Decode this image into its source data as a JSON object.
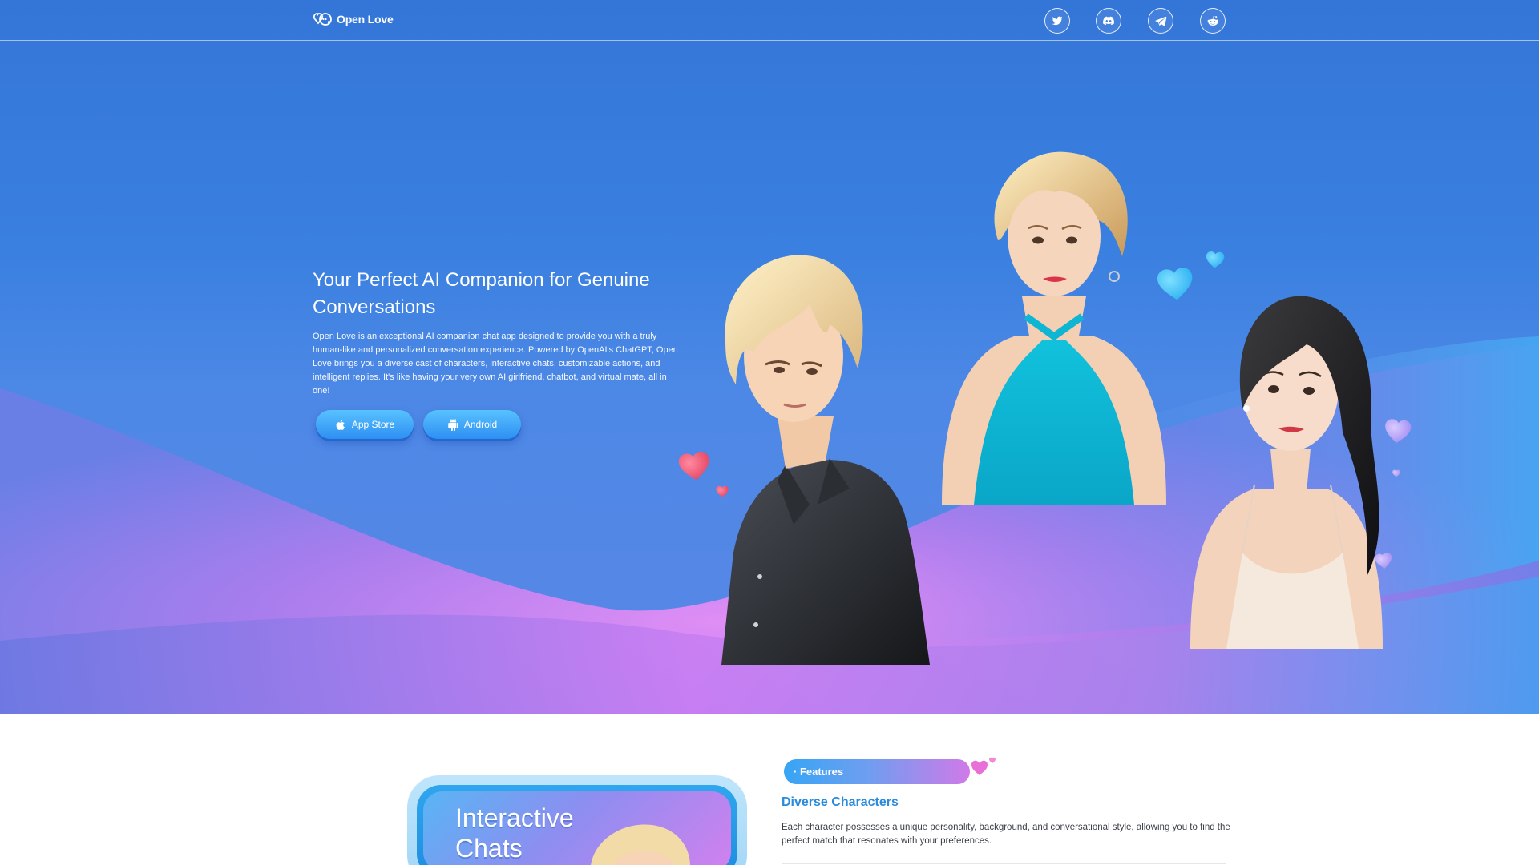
{
  "brand": {
    "name": "Open Love"
  },
  "social": [
    {
      "name": "twitter",
      "icon": "twitter-icon"
    },
    {
      "name": "discord",
      "icon": "discord-icon"
    },
    {
      "name": "telegram",
      "icon": "telegram-icon"
    },
    {
      "name": "reddit",
      "icon": "reddit-icon"
    }
  ],
  "hero": {
    "title": "Your Perfect AI Companion for Genuine Conversations",
    "description": "Open Love is an exceptional AI companion chat app designed to provide you with a truly human-like and personalized conversation experience. Powered by OpenAI's ChatGPT, Open Love brings you a diverse cast of characters, interactive chats, customizable actions, and intelligent replies. It's like having your very own AI girlfriend, chatbot, and virtual mate, all in one!",
    "buttons": {
      "app_store": "App Store",
      "android": "Android"
    }
  },
  "promo": {
    "title": "Interactive Chats"
  },
  "features": {
    "badge": "· Features",
    "title": "Diverse Characters",
    "description": "Each character possesses a unique personality, background, and conversational style, allowing you to find the perfect match that resonates with your preferences."
  },
  "colors": {
    "hero_blue": "#3476d8",
    "wave_purple": "#c27af0",
    "accent_blue": "#2a8bdc",
    "button_blue": "#2e8ff2"
  }
}
